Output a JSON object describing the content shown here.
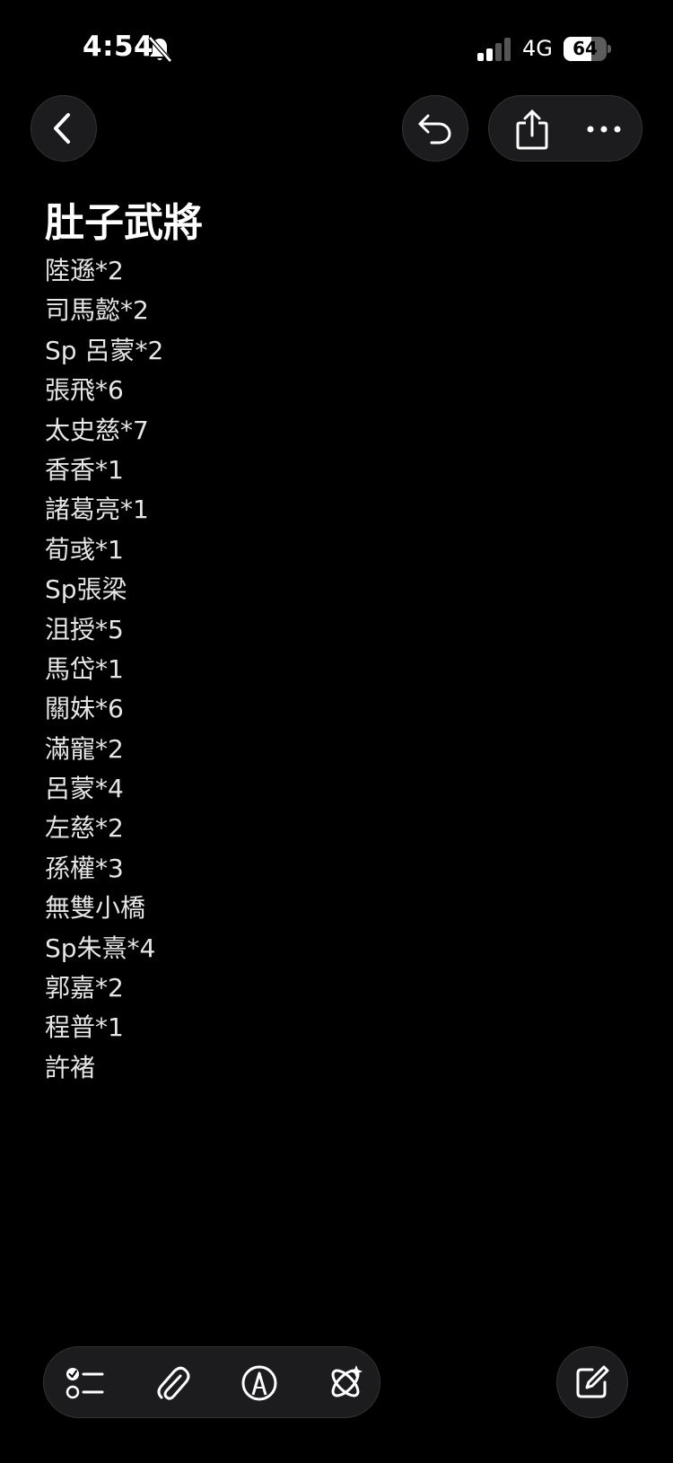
{
  "status_bar": {
    "time": "4:54",
    "network": "4G",
    "battery_level": "64",
    "battery_fraction": 0.64
  },
  "icons": {
    "back": "chevron-left-icon",
    "undo": "undo-icon",
    "share": "share-icon",
    "more": "ellipsis-icon",
    "checklist": "checklist-icon",
    "attach": "paperclip-icon",
    "markup": "markup-pen-icon",
    "ai": "apple-intelligence-icon",
    "compose": "compose-icon"
  },
  "note": {
    "title": "肚子武將",
    "lines": [
      "陸遜*2",
      "司馬懿*2",
      "Sp 呂蒙*2",
      "張飛*6",
      "太史慈*7",
      "香香*1",
      "諸葛亮*1",
      "荀彧*1",
      "Sp張梁",
      "沮授*5",
      "馬岱*1",
      "關妹*6",
      "滿寵*2",
      "呂蒙*4",
      "左慈*2",
      "孫權*3",
      "無雙小橋",
      "Sp朱熹*4",
      "郭嘉*2",
      "程普*1",
      "許褚"
    ]
  }
}
